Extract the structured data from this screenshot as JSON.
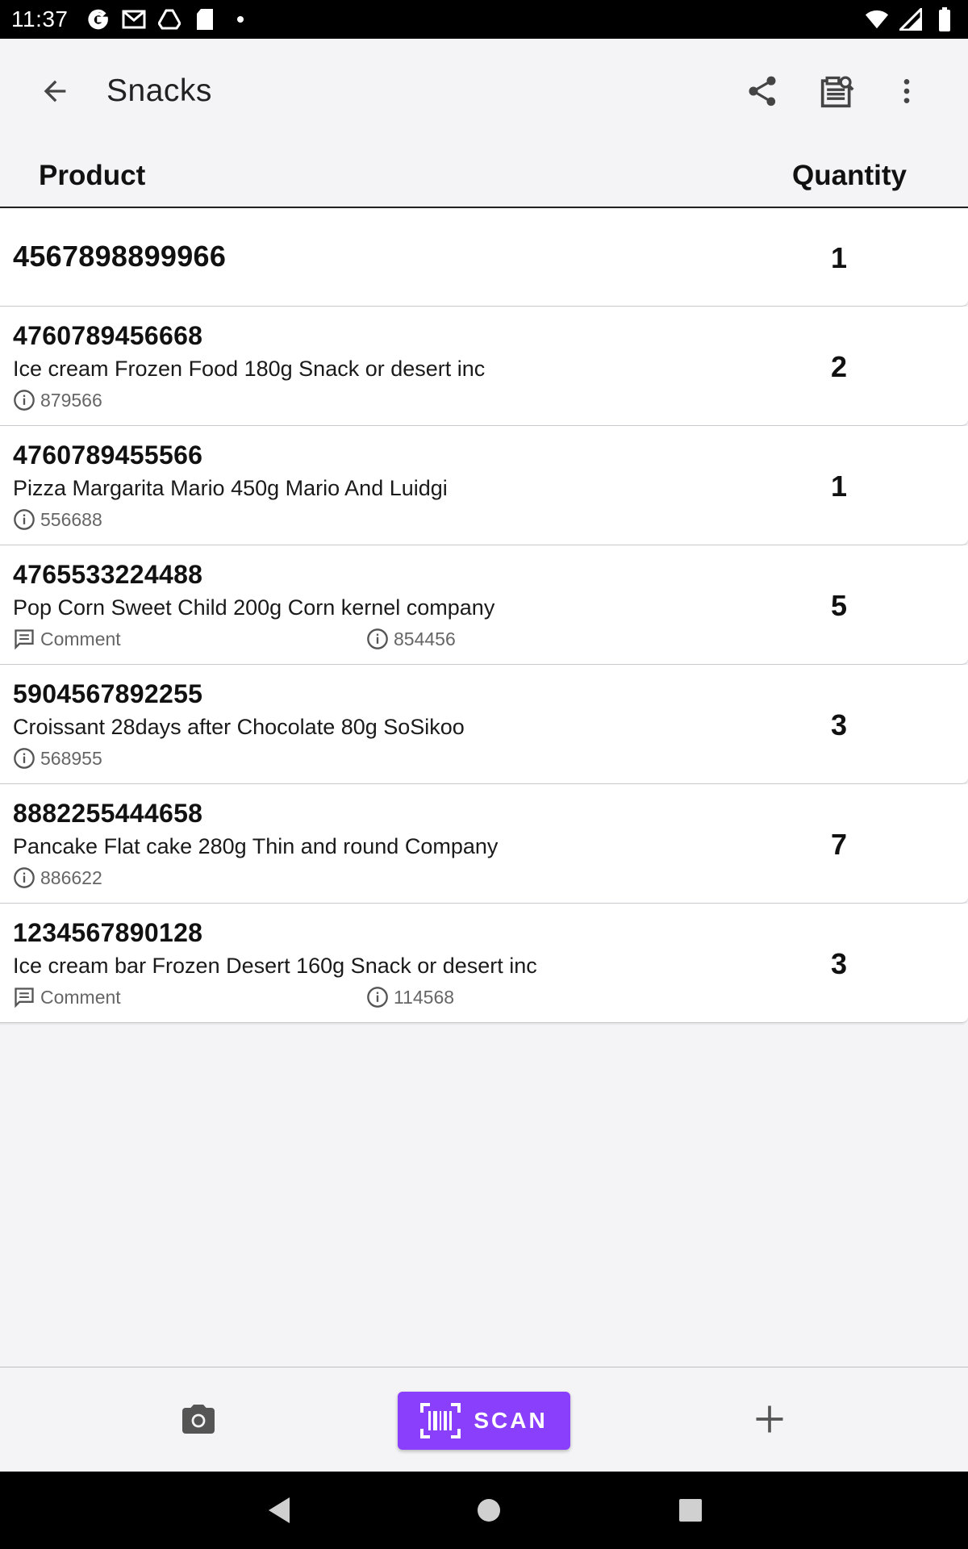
{
  "status_bar": {
    "time": "11:37",
    "left_icons": [
      "google-icon",
      "gmail-icon",
      "drive-icon",
      "sd-card-icon",
      "dot-icon"
    ],
    "right_icons": [
      "wifi-icon",
      "signal-icon",
      "battery-icon"
    ]
  },
  "app_bar": {
    "title": "Snacks",
    "actions": [
      "back-arrow-icon",
      "share-icon",
      "report-search-icon",
      "more-vert-icon"
    ]
  },
  "columns": {
    "product": "Product",
    "quantity": "Quantity"
  },
  "items": [
    {
      "barcode": "4567898899966",
      "name": "",
      "info": "",
      "comment": "",
      "quantity": "1"
    },
    {
      "barcode": "4760789456668",
      "name": "Ice cream Frozen Food 180g Snack or desert inc",
      "info": "879566",
      "comment": "",
      "quantity": "2"
    },
    {
      "barcode": "4760789455566",
      "name": "Pizza Margarita Mario 450g Mario And Luidgi",
      "info": "556688",
      "comment": "",
      "quantity": "1"
    },
    {
      "barcode": "4765533224488",
      "name": "Pop Corn Sweet Child 200g Corn kernel company",
      "info": "854456",
      "comment": "Comment",
      "quantity": "5"
    },
    {
      "barcode": "5904567892255",
      "name": "Croissant 28days after Chocolate 80g SoSikoo",
      "info": "568955",
      "comment": "",
      "quantity": "3"
    },
    {
      "barcode": "8882255444658",
      "name": "Pancake Flat cake 280g Thin and round Company",
      "info": "886622",
      "comment": "",
      "quantity": "7"
    },
    {
      "barcode": "1234567890128",
      "name": "Ice cream bar Frozen Desert 160g Snack or desert inc",
      "info": "114568",
      "comment": "Comment",
      "quantity": "3"
    }
  ],
  "bottom_bar": {
    "scan_label": "SCAN",
    "accent_color": "#8a3ffc",
    "icons": [
      "camera-icon",
      "barcode-scan-icon",
      "add-icon"
    ]
  }
}
